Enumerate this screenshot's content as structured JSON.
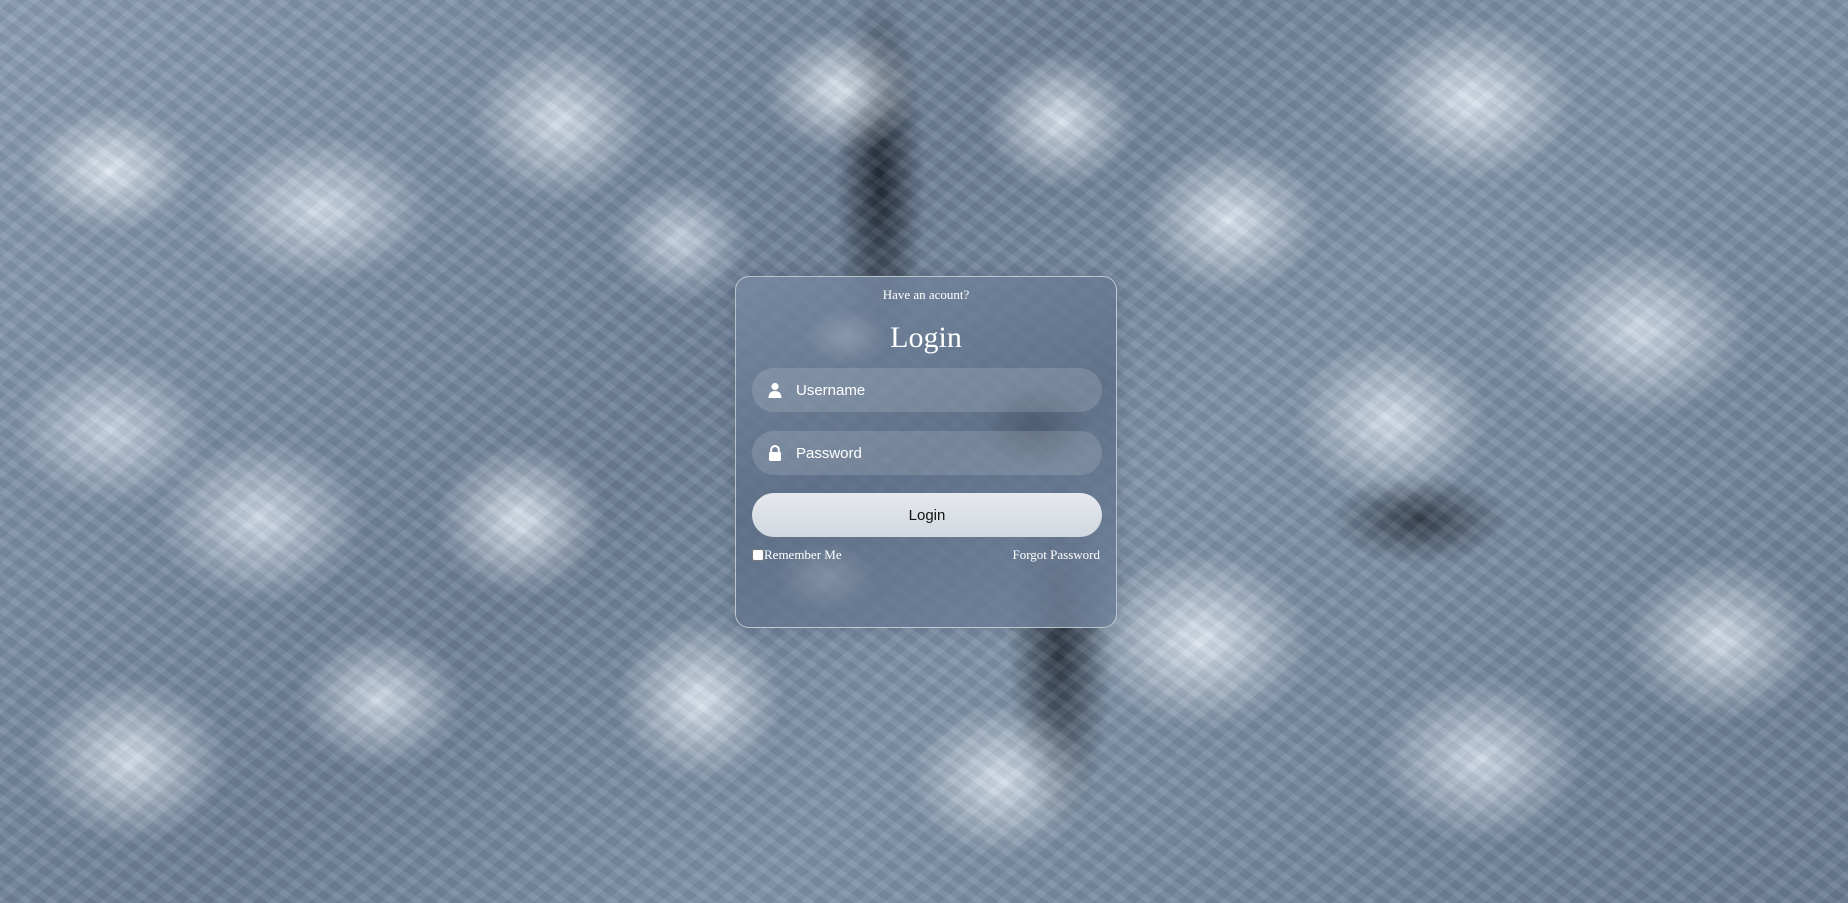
{
  "login_card": {
    "prompt": "Have an acount?",
    "title": "Login",
    "username": {
      "icon": "user-icon",
      "placeholder": "Username",
      "value": ""
    },
    "password": {
      "icon": "lock-icon",
      "placeholder": "Password",
      "value": ""
    },
    "login_button_label": "Login",
    "remember_me_label": "Remember Me",
    "remember_me_checked": false,
    "forgot_password_label": "Forgot Password"
  },
  "colors": {
    "card_text": "#ffffff",
    "button_background": "#e0e4ea",
    "button_text": "#111111"
  }
}
